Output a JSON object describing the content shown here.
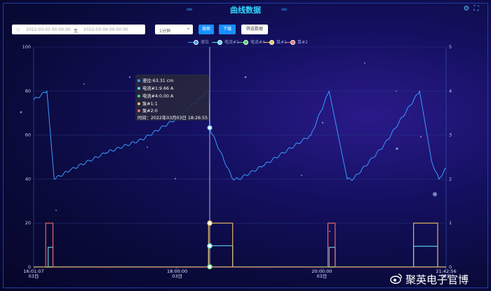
{
  "header": {
    "title": "曲线数据"
  },
  "toolbar": {
    "start_date": "2022-03-03 00:00:00",
    "separator": "至",
    "end_date": "2022-03-04 00:00:00",
    "interval": "1分钟",
    "search_label": "搜索",
    "download_label": "下载",
    "filter_label": "筛选数据"
  },
  "legend": [
    {
      "name": "液位",
      "color": "#3a9bff"
    },
    {
      "name": "电流#1",
      "color": "#5ad8f0"
    },
    {
      "name": "电流#4",
      "color": "#4cd36a"
    },
    {
      "name": "泵#1",
      "color": "#f0c060"
    },
    {
      "name": "泵#2",
      "color": "#f07070"
    }
  ],
  "tooltip": {
    "level": "液位:63.31 cm",
    "current1": "电流#1:9.66 A",
    "current4": "电流#4:0.00 A",
    "pump1": "泵#1:1",
    "pump2": "泵#2:0",
    "time": "时间：2022年03月03日 18:26:55"
  },
  "watermark": "聚英电子官博",
  "chart_data": {
    "type": "line",
    "title": "",
    "y_left": {
      "min": 0,
      "max": 100,
      "ticks": [
        0,
        20,
        40,
        60,
        80,
        100
      ]
    },
    "y_right": {
      "min": 0,
      "max": 5,
      "ticks": [
        0,
        1,
        2,
        3,
        4,
        5
      ]
    },
    "x_ticks": [
      {
        "label": "16:01:07",
        "sub": "03日",
        "t": 0
      },
      {
        "label": "18:00:00",
        "sub": "03日",
        "t": 119
      },
      {
        "label": "20:00:00",
        "sub": "03日",
        "t": 239
      },
      {
        "label": "21:42:56",
        "sub": "03日",
        "t": 342
      }
    ],
    "x_range": [
      0,
      342
    ],
    "cursor_t": 146,
    "series": [
      {
        "name": "液位",
        "axis": "left",
        "color": "#3a9bff",
        "points": [
          [
            0,
            76
          ],
          [
            3,
            77
          ],
          [
            11,
            80
          ],
          [
            17,
            40
          ],
          [
            30,
            44
          ],
          [
            60,
            52
          ],
          [
            90,
            58
          ],
          [
            120,
            68
          ],
          [
            145,
            80
          ],
          [
            146,
            63
          ],
          [
            165,
            40
          ],
          [
            170,
            40
          ],
          [
            190,
            46
          ],
          [
            230,
            60
          ],
          [
            245,
            80
          ],
          [
            260,
            40
          ],
          [
            265,
            40
          ],
          [
            290,
            55
          ],
          [
            320,
            80
          ],
          [
            330,
            48
          ],
          [
            336,
            40
          ],
          [
            342,
            45
          ]
        ]
      },
      {
        "name": "电流#1",
        "axis": "left",
        "color": "#5ad8f0",
        "points": [
          [
            0,
            0
          ],
          [
            12,
            0
          ],
          [
            12,
            9
          ],
          [
            16,
            9
          ],
          [
            16,
            0
          ],
          [
            145,
            0
          ],
          [
            145,
            9.7
          ],
          [
            165,
            9.7
          ],
          [
            165,
            0
          ],
          [
            245,
            0
          ],
          [
            245,
            9
          ],
          [
            250,
            9
          ],
          [
            250,
            0
          ],
          [
            315,
            0
          ],
          [
            315,
            9.5
          ],
          [
            335,
            9.5
          ],
          [
            335,
            0
          ],
          [
            342,
            0
          ]
        ]
      },
      {
        "name": "电流#4",
        "axis": "left",
        "color": "#4cd36a",
        "points": [
          [
            0,
            0.2
          ],
          [
            342,
            0.2
          ]
        ]
      },
      {
        "name": "泵#1",
        "axis": "right",
        "color": "#f0c060",
        "points": [
          [
            0,
            0
          ],
          [
            145,
            0
          ],
          [
            145,
            1
          ],
          [
            165,
            1
          ],
          [
            165,
            0
          ],
          [
            315,
            0
          ],
          [
            315,
            1
          ],
          [
            335,
            1
          ],
          [
            335,
            0
          ],
          [
            342,
            0
          ]
        ]
      },
      {
        "name": "泵#2",
        "axis": "right",
        "color": "#f07070",
        "points": [
          [
            0,
            0
          ],
          [
            10,
            0
          ],
          [
            10,
            1
          ],
          [
            16,
            1
          ],
          [
            16,
            0
          ],
          [
            244,
            0
          ],
          [
            244,
            1
          ],
          [
            250,
            1
          ],
          [
            250,
            0
          ],
          [
            342,
            0
          ]
        ]
      }
    ]
  }
}
